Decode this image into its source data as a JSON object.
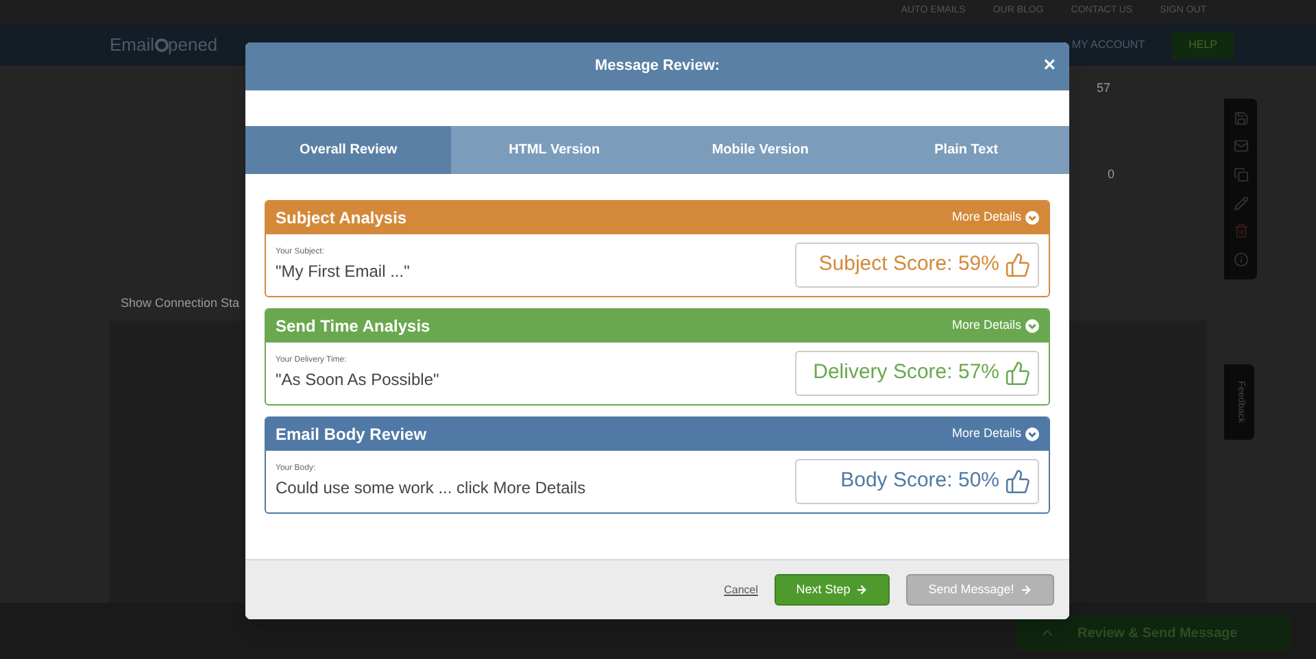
{
  "top_links": [
    "AUTO EMAILS",
    "OUR BLOG",
    "CONTACT US",
    "SIGN OUT"
  ],
  "logo": {
    "before": "Email",
    "after": "pened"
  },
  "nav": {
    "account": "MY ACCOUNT",
    "help": "HELP"
  },
  "background": {
    "count_1": "57",
    "count_2": "0",
    "link": "Show Connection Sta",
    "feedback": "Feedback",
    "send_button": "Review & Send Message"
  },
  "modal": {
    "title": "Message Review:",
    "close": "×",
    "tabs": [
      {
        "label": "Overall Review",
        "selected": true
      },
      {
        "label": "HTML Version",
        "selected": false
      },
      {
        "label": "Mobile Version",
        "selected": false
      },
      {
        "label": "Plain Text",
        "selected": false
      }
    ],
    "cards": [
      {
        "title": "Subject Analysis",
        "color": "#d4893a",
        "more": "More Details",
        "field_label": "Your Subject:",
        "value": "\"My First Email ...\"",
        "score": "Subject Score: 59%"
      },
      {
        "title": "Send Time Analysis",
        "color": "#6aa84f",
        "more": "More Details",
        "field_label": "Your Delivery Time:",
        "value": "\"As Soon As Possible\"",
        "score": "Delivery Score: 57%"
      },
      {
        "title": "Email Body Review",
        "color": "#5079a5",
        "more": "More Details",
        "field_label": "Your Body:",
        "value": "Could use some work ... click More Details",
        "score": "Body Score: 50%"
      }
    ],
    "cancel": "Cancel",
    "next": "Next Step",
    "send": "Send Message!"
  }
}
